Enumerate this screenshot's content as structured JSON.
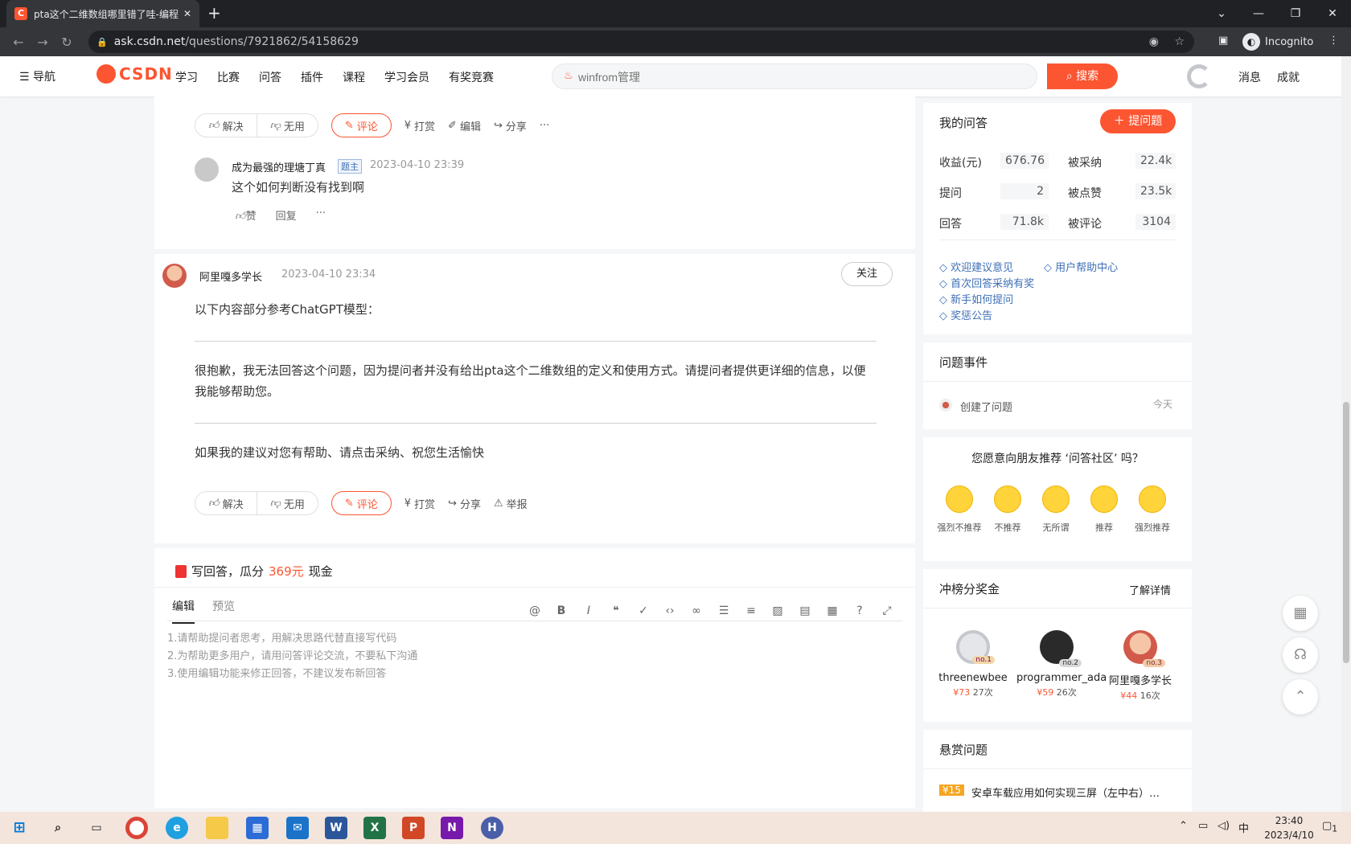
{
  "browser": {
    "tab_title": "pta这个二维数组哪里错了哇-编程",
    "tab_favicon": "C",
    "url_host": "ask.csdn.net",
    "url_path": "/questions/7921862/54158629",
    "profile_label": "Incognito"
  },
  "header": {
    "nav_label": "导航",
    "logo_text": "CSDN",
    "nav_items": [
      "学习",
      "比赛",
      "问答",
      "插件",
      "课程",
      "学习会员",
      "有奖竞赛"
    ],
    "search_placeholder": "winfrom管理",
    "search_button": "搜索",
    "right_links": [
      "消息",
      "成就"
    ]
  },
  "actions_1": {
    "solve": "解决",
    "useless": "无用",
    "comment": "评论",
    "reward": "打赏",
    "edit": "编辑",
    "share": "分享",
    "more": "···"
  },
  "comment": {
    "author": "成为最强的理塘丁真",
    "badge": "题主",
    "time": "2023-04-10 23:39",
    "text": "这个如何判断没有找到啊",
    "like": "赞",
    "reply": "回复",
    "more": "···"
  },
  "answer": {
    "author": "阿里嘎多学长",
    "time": "2023-04-10 23:34",
    "follow": "关注",
    "p1": "以下内容部分参考ChatGPT模型：",
    "p2": "很抱歉，我无法回答这个问题，因为提问者并没有给出pta这个二维数组的定义和使用方式。请提问者提供更详细的信息，以便我能够帮助您。",
    "p3": "如果我的建议对您有帮助、请点击采纳、祝您生活愉快"
  },
  "actions_2": {
    "solve": "解决",
    "useless": "无用",
    "comment": "评论",
    "reward": "打赏",
    "share": "分享",
    "report": "举报"
  },
  "write": {
    "title_pre": "写回答，瓜分",
    "amount": "369元",
    "title_post": "现金",
    "tab_edit": "编辑",
    "tab_preview": "预览",
    "hints": [
      "1.请帮助提问者思考，用解决思路代替直接写代码",
      "2.为帮助更多用户，请用问答评论交流，不要私下沟通",
      "3.使用编辑功能来修正回答，不建议发布新回答"
    ]
  },
  "sidebar": {
    "my_qa_title": "我的问答",
    "ask_button": "提问题",
    "stats": [
      {
        "label": "收益(元)",
        "value": "676.76"
      },
      {
        "label": "被采纳",
        "value": "22.4k"
      },
      {
        "label": "提问",
        "value": "2"
      },
      {
        "label": "被点赞",
        "value": "23.5k"
      },
      {
        "label": "回答",
        "value": "71.8k"
      },
      {
        "label": "被评论",
        "value": "3104"
      }
    ],
    "links": [
      "欢迎建议意见",
      "用户帮助中心",
      "首次回答采纳有奖",
      "新手如何提问",
      "奖惩公告"
    ],
    "event_title": "问题事件",
    "event_text": "创建了问题",
    "event_time": "今天",
    "recommend_question": "您愿意向朋友推荐 ‘问答社区’ 吗？",
    "emojis": [
      "强烈不推荐",
      "不推荐",
      "无所谓",
      "推荐",
      "强烈推荐"
    ],
    "ranking_title": "冲榜分奖金",
    "ranking_more": "了解详情",
    "ranking": [
      {
        "name": "threenewbee",
        "no": "no.1",
        "money": "¥73",
        "count": "27次"
      },
      {
        "name": "programmer_ada",
        "no": "no.2",
        "money": "¥59",
        "count": "26次"
      },
      {
        "name": "阿里嘎多学长",
        "no": "no.3",
        "money": "¥44",
        "count": "16次"
      }
    ],
    "bounty_title": "悬赏问题",
    "bounty_badge": "¥15",
    "bounty_text": "安卓车载应用如何实现三屏（左中右）…"
  },
  "taskbar": {
    "time": "23:40",
    "date": "2023/4/10",
    "ime": "中",
    "notif": "1"
  }
}
